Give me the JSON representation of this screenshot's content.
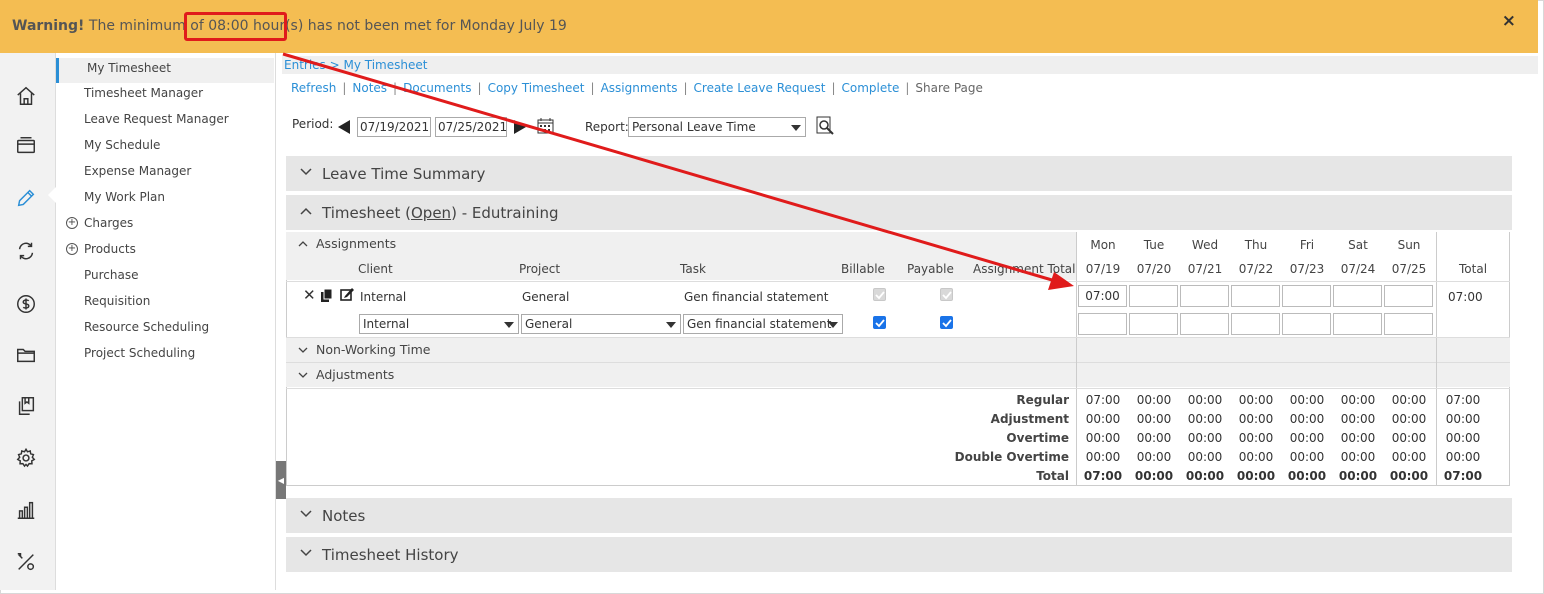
{
  "warning": {
    "prefix": "Warning!",
    "text_before": " The minimum of ",
    "highlight": "08:00 hour(s)",
    "text_after": " has not been met for Monday July 19",
    "close": "×"
  },
  "rail_icons": [
    "home-icon",
    "card-icon",
    "pencil-icon",
    "sync-icon",
    "dollar-icon",
    "folder-icon",
    "documents-icon",
    "gear-icon",
    "bar-chart-icon",
    "tools-icon"
  ],
  "menu": {
    "items": [
      {
        "label": "My Timesheet"
      },
      {
        "label": "Timesheet Manager"
      },
      {
        "label": "Leave Request Manager"
      },
      {
        "label": "My Schedule"
      },
      {
        "label": "Expense Manager"
      },
      {
        "label": "My Work Plan"
      },
      {
        "label": "Charges",
        "expand": "+"
      },
      {
        "label": "Products",
        "expand": "+"
      },
      {
        "label": "Purchase"
      },
      {
        "label": "Requisition"
      },
      {
        "label": "Resource Scheduling"
      },
      {
        "label": "Project Scheduling"
      }
    ]
  },
  "breadcrumb": "Entries > My Timesheet",
  "links": [
    "Refresh",
    "Notes",
    "Documents",
    "Copy Timesheet",
    "Assignments",
    "Create Leave Request",
    "Complete"
  ],
  "link_plain": "Share Page",
  "period": {
    "label": "Period:",
    "start": "07/19/2021",
    "end": "07/25/2021"
  },
  "report": {
    "label": "Report:",
    "value": "Personal Leave Time"
  },
  "sections": {
    "leave": "Leave Time Summary",
    "timesheet_prefix": "Timesheet (",
    "timesheet_status": "Open",
    "timesheet_suffix": ")  - Edutraining",
    "notes": "Notes",
    "history": "Timesheet History"
  },
  "subsections": {
    "assignments": "Assignments",
    "non_working": "Non-Working Time",
    "adjustments": "Adjustments"
  },
  "columns": {
    "client": "Client",
    "project": "Project",
    "task": "Task",
    "billable": "Billable",
    "payable": "Payable",
    "assignment_total": "Assignment Total",
    "total": "Total"
  },
  "days": [
    {
      "name": "Mon",
      "date": "07/19"
    },
    {
      "name": "Tue",
      "date": "07/20"
    },
    {
      "name": "Wed",
      "date": "07/21"
    },
    {
      "name": "Thu",
      "date": "07/22"
    },
    {
      "name": "Fri",
      "date": "07/23"
    },
    {
      "name": "Sat",
      "date": "07/24"
    },
    {
      "name": "Sun",
      "date": "07/25"
    }
  ],
  "row1": {
    "client": "Internal",
    "project": "General",
    "task": "Gen financial statement",
    "mon": "07:00",
    "total": "07:00"
  },
  "row2": {
    "client": "Internal",
    "project": "General",
    "task": "Gen financial statement"
  },
  "totals": {
    "rows": [
      {
        "label": "Regular",
        "values": [
          "07:00",
          "00:00",
          "00:00",
          "00:00",
          "00:00",
          "00:00",
          "00:00"
        ],
        "total": "07:00"
      },
      {
        "label": "Adjustment",
        "values": [
          "00:00",
          "00:00",
          "00:00",
          "00:00",
          "00:00",
          "00:00",
          "00:00"
        ],
        "total": "00:00"
      },
      {
        "label": "Overtime",
        "values": [
          "00:00",
          "00:00",
          "00:00",
          "00:00",
          "00:00",
          "00:00",
          "00:00"
        ],
        "total": "00:00"
      },
      {
        "label": "Double Overtime",
        "values": [
          "00:00",
          "00:00",
          "00:00",
          "00:00",
          "00:00",
          "00:00",
          "00:00"
        ],
        "total": "00:00"
      },
      {
        "label": "Total",
        "values": [
          "07:00",
          "00:00",
          "00:00",
          "00:00",
          "00:00",
          "00:00",
          "00:00"
        ],
        "total": "07:00"
      }
    ]
  },
  "colors": {
    "warning_bg": "#f4bd52",
    "link": "#2b8fd6",
    "annotation": "#e01b1b",
    "checkbox": "#1a73e8"
  }
}
